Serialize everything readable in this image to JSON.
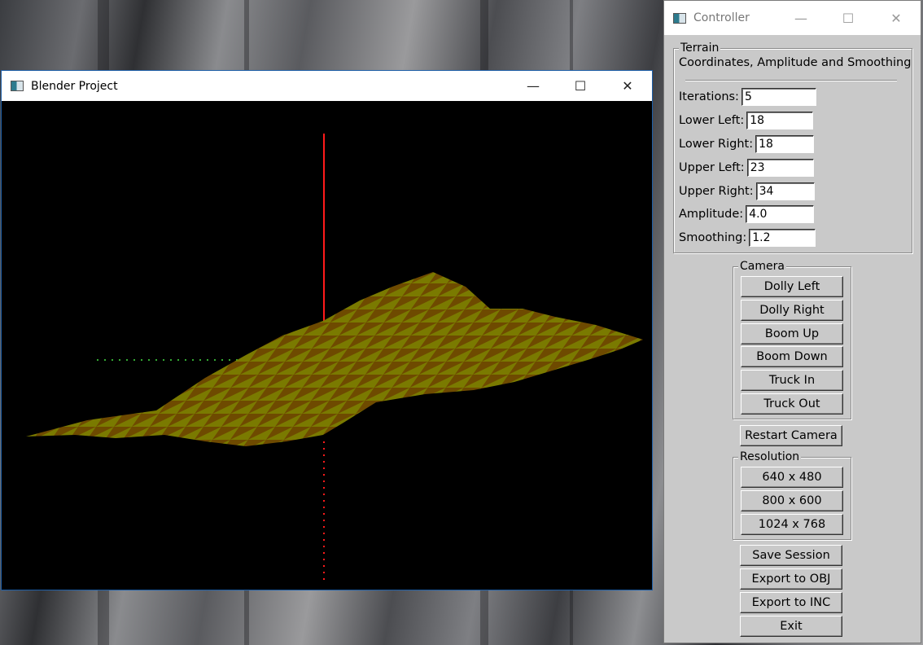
{
  "blender_window": {
    "title": "Blender Project",
    "terrain_color_a": "#7a7a00",
    "terrain_color_b": "#6e4a00",
    "y_axis_color": "#ff1a1a",
    "x_axis_color": "#33aa33"
  },
  "controller": {
    "title": "Controller",
    "terrain": {
      "legend": "Terrain",
      "subtitle": "Coordinates, Amplitude and Smoothing",
      "fields": [
        {
          "label": "Iterations:",
          "value": "5"
        },
        {
          "label": "Lower Left:",
          "value": "18"
        },
        {
          "label": "Lower Right:",
          "value": "18"
        },
        {
          "label": "Upper Left:",
          "value": "23"
        },
        {
          "label": "Upper Right:",
          "value": "34"
        },
        {
          "label": "Amplitude:",
          "value": "4.0"
        },
        {
          "label": "Smoothing:",
          "value": "1.2"
        }
      ]
    },
    "camera": {
      "legend": "Camera",
      "buttons": [
        "Dolly Left",
        "Dolly Right",
        "Boom Up",
        "Boom Down",
        "Truck In",
        "Truck Out"
      ]
    },
    "restart_camera": "Restart Camera",
    "resolution": {
      "legend": "Resolution",
      "buttons": [
        "640 x 480",
        "800 x 600",
        "1024 x 768"
      ]
    },
    "actions": [
      "Save Session",
      "Export to OBJ",
      "Export to INC",
      "Exit"
    ]
  },
  "window_controls": {
    "minimize": "—",
    "maximize": "☐",
    "close": "✕"
  }
}
